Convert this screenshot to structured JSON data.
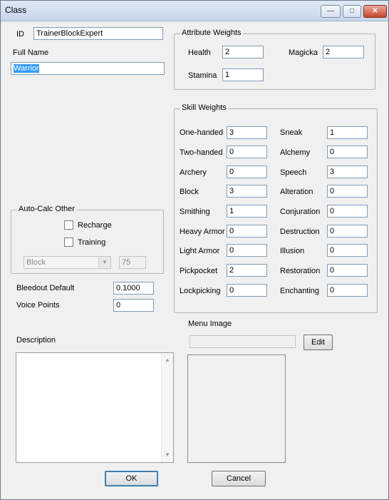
{
  "window": {
    "title": "Class",
    "minimize_glyph": "—",
    "maximize_glyph": "□",
    "close_glyph": "✕"
  },
  "id": {
    "label": "ID",
    "value": "TrainerBlockExpert"
  },
  "full_name": {
    "label": "Full Name",
    "value": "Warrior"
  },
  "attributes": {
    "title": "Attribute Weights",
    "health": {
      "label": "Health",
      "value": "2"
    },
    "magicka": {
      "label": "Magicka",
      "value": "2"
    },
    "stamina": {
      "label": "Stamina",
      "value": "1"
    }
  },
  "skills": {
    "title": "Skill Weights",
    "left": [
      {
        "label": "One-handed",
        "value": "3"
      },
      {
        "label": "Two-handed",
        "value": "0"
      },
      {
        "label": "Archery",
        "value": "0"
      },
      {
        "label": "Block",
        "value": "3"
      },
      {
        "label": "Smithing",
        "value": "1"
      },
      {
        "label": "Heavy Armor",
        "value": "0"
      },
      {
        "label": "Light Armor",
        "value": "0"
      },
      {
        "label": "Pickpocket",
        "value": "2"
      },
      {
        "label": "Lockpicking",
        "value": "0"
      }
    ],
    "right": [
      {
        "label": "Sneak",
        "value": "1"
      },
      {
        "label": "Alchemy",
        "value": "0"
      },
      {
        "label": "Speech",
        "value": "3"
      },
      {
        "label": "Alteration",
        "value": "0"
      },
      {
        "label": "Conjuration",
        "value": "0"
      },
      {
        "label": "Destruction",
        "value": "0"
      },
      {
        "label": "Illusion",
        "value": "0"
      },
      {
        "label": "Restoration",
        "value": "0"
      },
      {
        "label": "Enchanting",
        "value": "0"
      }
    ]
  },
  "autocalc": {
    "title": "Auto-Calc Other",
    "recharge_label": "Recharge",
    "recharge_checked": false,
    "training_label": "Training",
    "training_checked": false,
    "skill_select": "Block",
    "skill_value": "75"
  },
  "bleedout": {
    "label": "Bleedout Default",
    "value": "0.1000"
  },
  "voice_points": {
    "label": "Voice Points",
    "value": "0"
  },
  "description": {
    "label": "Description",
    "value": ""
  },
  "menu_image": {
    "label": "Menu Image",
    "path": "",
    "edit_label": "Edit"
  },
  "buttons": {
    "ok": "OK",
    "cancel": "Cancel"
  }
}
